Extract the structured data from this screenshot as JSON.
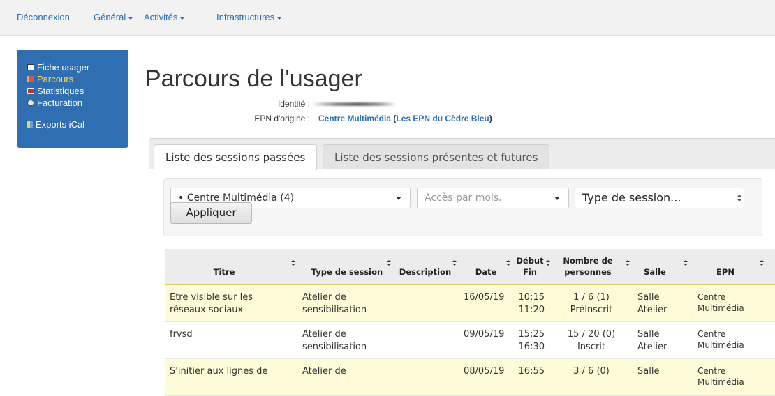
{
  "navbar": {
    "logout": "Déconnexion",
    "general": "Général",
    "activities": "Activités",
    "infrastructures": "Infrastructures"
  },
  "sidebar": {
    "items": [
      {
        "label": "Fiche usager",
        "icon": "user-card-icon",
        "active": false
      },
      {
        "label": "Parcours",
        "icon": "book-icon",
        "active": true
      },
      {
        "label": "Statistiques",
        "icon": "chart-icon",
        "active": false
      },
      {
        "label": "Facturation",
        "icon": "invoice-icon",
        "active": false
      }
    ],
    "exports": {
      "label": "Exports iCal",
      "icon": "calendar-export-icon"
    }
  },
  "header": {
    "title": "Parcours de l'usager",
    "identity_label": "Identité :",
    "epn_label": "EPN d'origine :",
    "epn_name": "Centre Multimédia",
    "epn_group_open": " (",
    "epn_group": "Les EPN du Cèdre Bleu",
    "epn_group_close": ")"
  },
  "tabs": {
    "past": "Liste des sessions passées",
    "future": "Liste des sessions présentes et futures"
  },
  "filters": {
    "epn_select": "• Centre Multimédia (4)",
    "month_select": "Accès par mois.",
    "type_select": "Type de session...",
    "apply_button": "Appliquer"
  },
  "table": {
    "headers": {
      "titre": "Titre",
      "type": "Type de session",
      "description": "Description",
      "date": "Date",
      "debut": "Début",
      "fin": "Fin",
      "nombre_1": "Nombre de",
      "nombre_2": "personnes",
      "salle": "Salle",
      "epn": "EPN"
    },
    "rows": [
      {
        "titre_1": "Etre visible sur les",
        "titre_2": "réseaux sociaux",
        "type_1": "Atelier de",
        "type_2": "sensibilisation",
        "date": "16/05/19",
        "debut": "10:15",
        "fin": "11:20",
        "count": "1 / 6 (1)",
        "status": "Préinscrit",
        "salle_1": "Salle",
        "salle_2": "Atelier",
        "epn_1": "Centre",
        "epn_2": "Multimédia"
      },
      {
        "titre_1": "frvsd",
        "titre_2": "",
        "type_1": "Atelier de",
        "type_2": "sensibilisation",
        "date": "09/05/19",
        "debut": "15:25",
        "fin": "16:30",
        "count": "15 / 20 (0)",
        "status": "Inscrit",
        "salle_1": "Salle",
        "salle_2": "Atelier",
        "epn_1": "Centre",
        "epn_2": "Multimédia"
      },
      {
        "titre_1": "S'initier aux lignes de",
        "titre_2": "",
        "type_1": "Atelier de",
        "type_2": "",
        "date": "08/05/19",
        "debut": "16:55",
        "fin": "",
        "count": "3 / 6 (0)",
        "status": "",
        "salle_1": "Salle",
        "salle_2": "",
        "epn_1": "Centre",
        "epn_2": "Multimédia"
      }
    ]
  },
  "colors": {
    "primary": "#2a6fb5",
    "sidebar_bg": "#2f6fb1",
    "active_item": "#ffd84a",
    "highlight_row": "#fefbd8"
  }
}
